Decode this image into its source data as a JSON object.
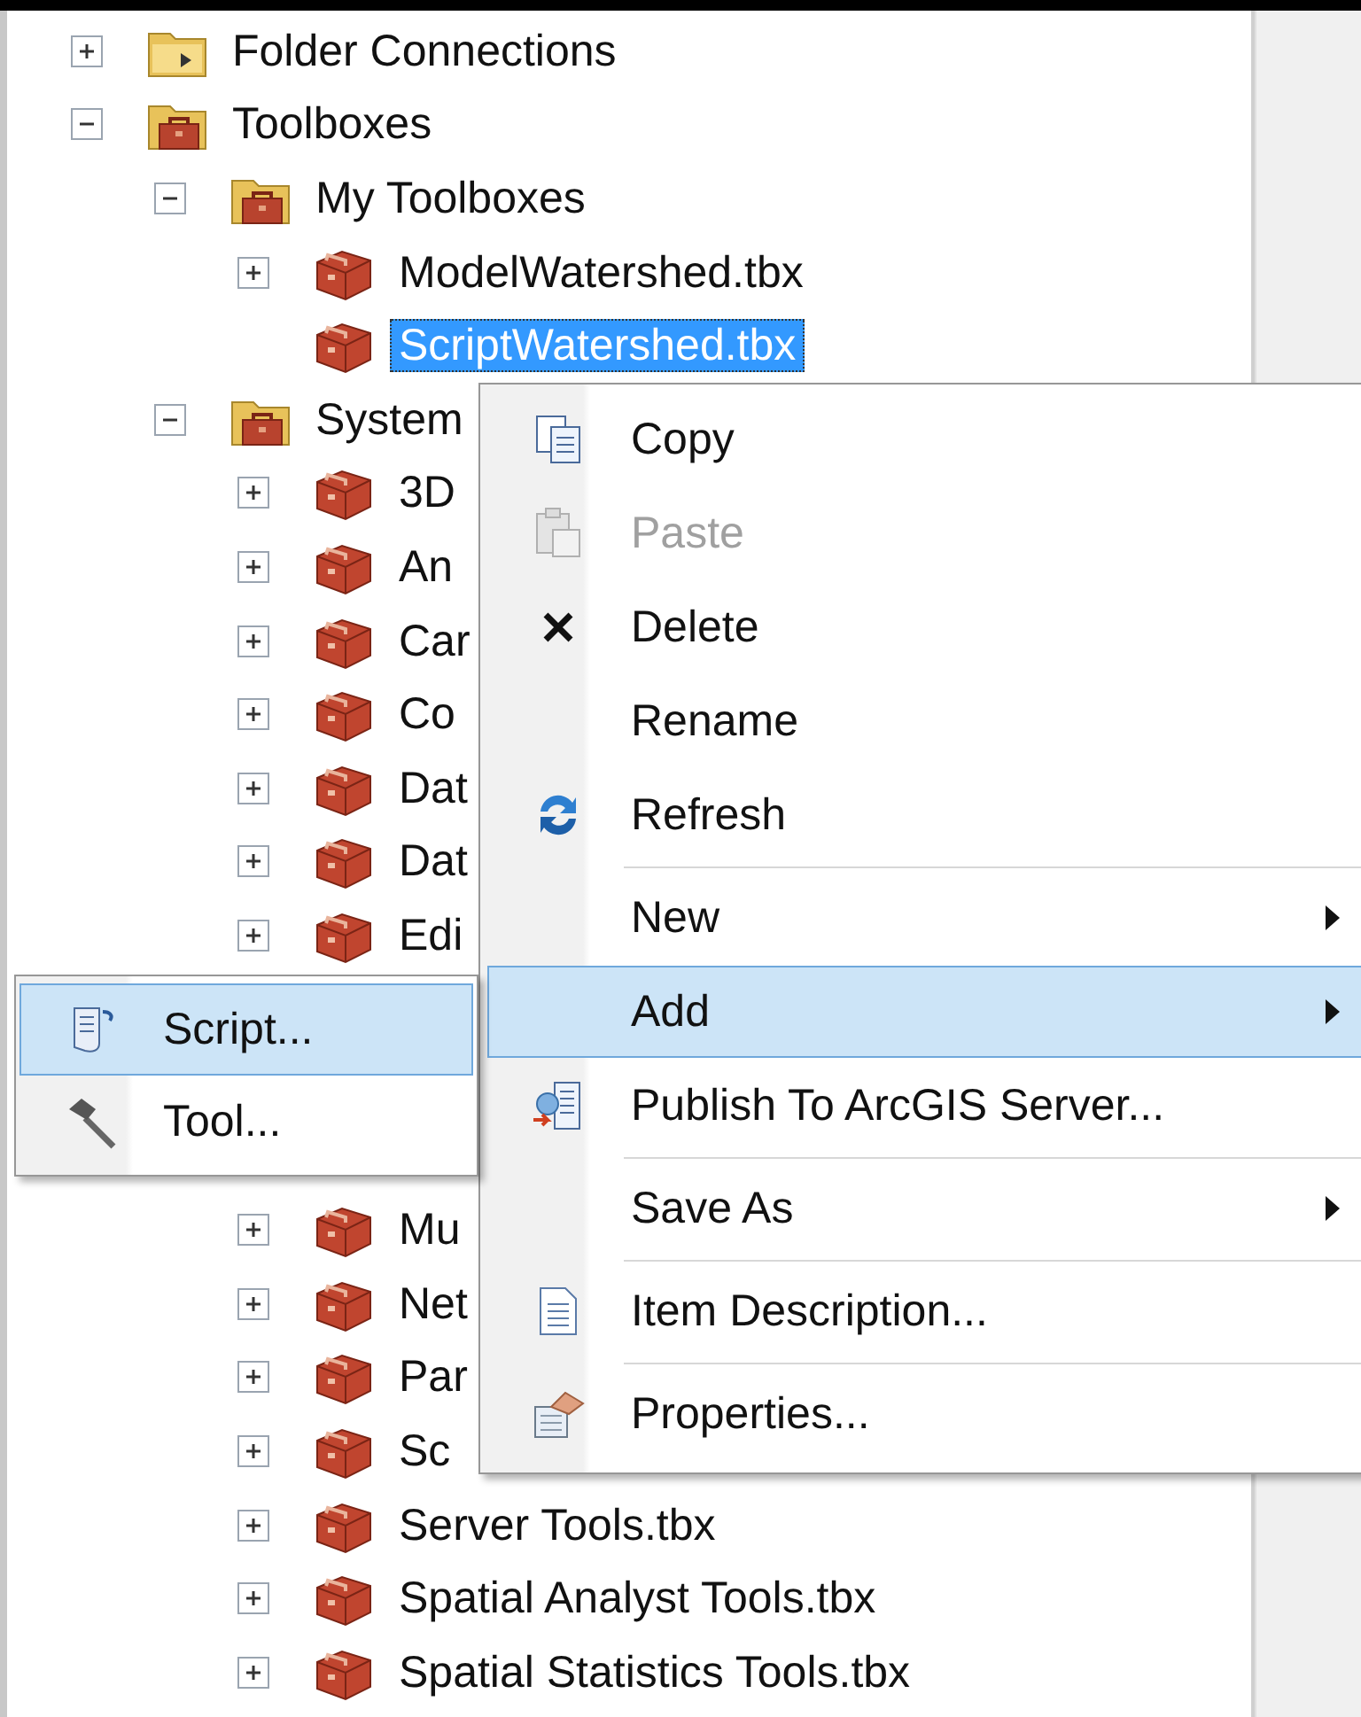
{
  "tree": [
    {
      "label": "Folder Connections",
      "kind": "folder",
      "expanded": false,
      "selected": false
    },
    {
      "label": "Toolboxes",
      "kind": "toolbox_folder",
      "expanded": true,
      "selected": false,
      "children": [
        {
          "label": "My Toolboxes",
          "kind": "toolbox_folder",
          "expanded": true,
          "selected": false,
          "children": [
            {
              "label": "ModelWatershed.tbx",
              "kind": "toolbox",
              "expanded": false,
              "selected": false
            },
            {
              "label": "ScriptWatershed.tbx",
              "kind": "toolbox",
              "selected": true
            }
          ]
        },
        {
          "label": "System",
          "kind": "toolbox_folder",
          "expanded": true,
          "selected": false,
          "children": [
            {
              "label": "3D",
              "kind": "toolbox",
              "expanded": false,
              "selected": false
            },
            {
              "label": "An",
              "kind": "toolbox",
              "expanded": false,
              "selected": false
            },
            {
              "label": "Car",
              "kind": "toolbox",
              "expanded": false,
              "selected": false
            },
            {
              "label": "Co",
              "kind": "toolbox",
              "expanded": false,
              "selected": false
            },
            {
              "label": "Dat",
              "kind": "toolbox",
              "expanded": false,
              "selected": false
            },
            {
              "label": "Dat",
              "kind": "toolbox",
              "expanded": false,
              "selected": false
            },
            {
              "label": "Edi",
              "kind": "toolbox",
              "expanded": false,
              "selected": false
            },
            {
              "kind": "covered"
            },
            {
              "kind": "covered"
            },
            {
              "kind": "covered"
            },
            {
              "label": "Mu",
              "kind": "toolbox",
              "expanded": false,
              "selected": false
            },
            {
              "label": "Net",
              "kind": "toolbox",
              "expanded": false,
              "selected": false
            },
            {
              "label": "Par",
              "kind": "toolbox",
              "expanded": false,
              "selected": false
            },
            {
              "label": "Sc",
              "kind": "toolbox",
              "expanded": false,
              "selected": false
            },
            {
              "label": "Server Tools.tbx",
              "kind": "toolbox",
              "expanded": false,
              "selected": false
            },
            {
              "label": "Spatial Analyst Tools.tbx",
              "kind": "toolbox",
              "expanded": false,
              "selected": false
            },
            {
              "label": "Spatial Statistics Tools.tbx",
              "kind": "toolbox",
              "expanded": false,
              "selected": false
            }
          ]
        }
      ]
    }
  ],
  "context_menu": {
    "items": [
      {
        "label": "Copy",
        "disabled": false,
        "selected": false,
        "submenu": false,
        "separator_before": false
      },
      {
        "label": "Paste",
        "disabled": true,
        "selected": false,
        "submenu": false,
        "separator_before": false
      },
      {
        "label": "Delete",
        "disabled": false,
        "selected": false,
        "submenu": false,
        "separator_before": false
      },
      {
        "label": "Rename",
        "disabled": false,
        "selected": false,
        "submenu": false,
        "separator_before": false
      },
      {
        "label": "Refresh",
        "disabled": false,
        "selected": false,
        "submenu": false,
        "separator_before": false
      },
      {
        "label": "New",
        "disabled": false,
        "selected": false,
        "submenu": true,
        "separator_before": true
      },
      {
        "label": "Add",
        "disabled": false,
        "selected": true,
        "submenu": true,
        "separator_before": false
      },
      {
        "label": "Publish To ArcGIS Server...",
        "disabled": false,
        "selected": false,
        "submenu": false,
        "separator_before": false
      },
      {
        "label": "Save As",
        "disabled": false,
        "selected": false,
        "submenu": true,
        "separator_before": true
      },
      {
        "label": "Item Description...",
        "disabled": false,
        "selected": false,
        "submenu": false,
        "separator_before": true
      },
      {
        "label": "Properties...",
        "disabled": false,
        "selected": false,
        "submenu": false,
        "separator_before": true
      }
    ]
  },
  "submenu": {
    "items": [
      {
        "label": "Script...",
        "selected": true
      },
      {
        "label": "Tool...",
        "selected": false
      }
    ]
  }
}
